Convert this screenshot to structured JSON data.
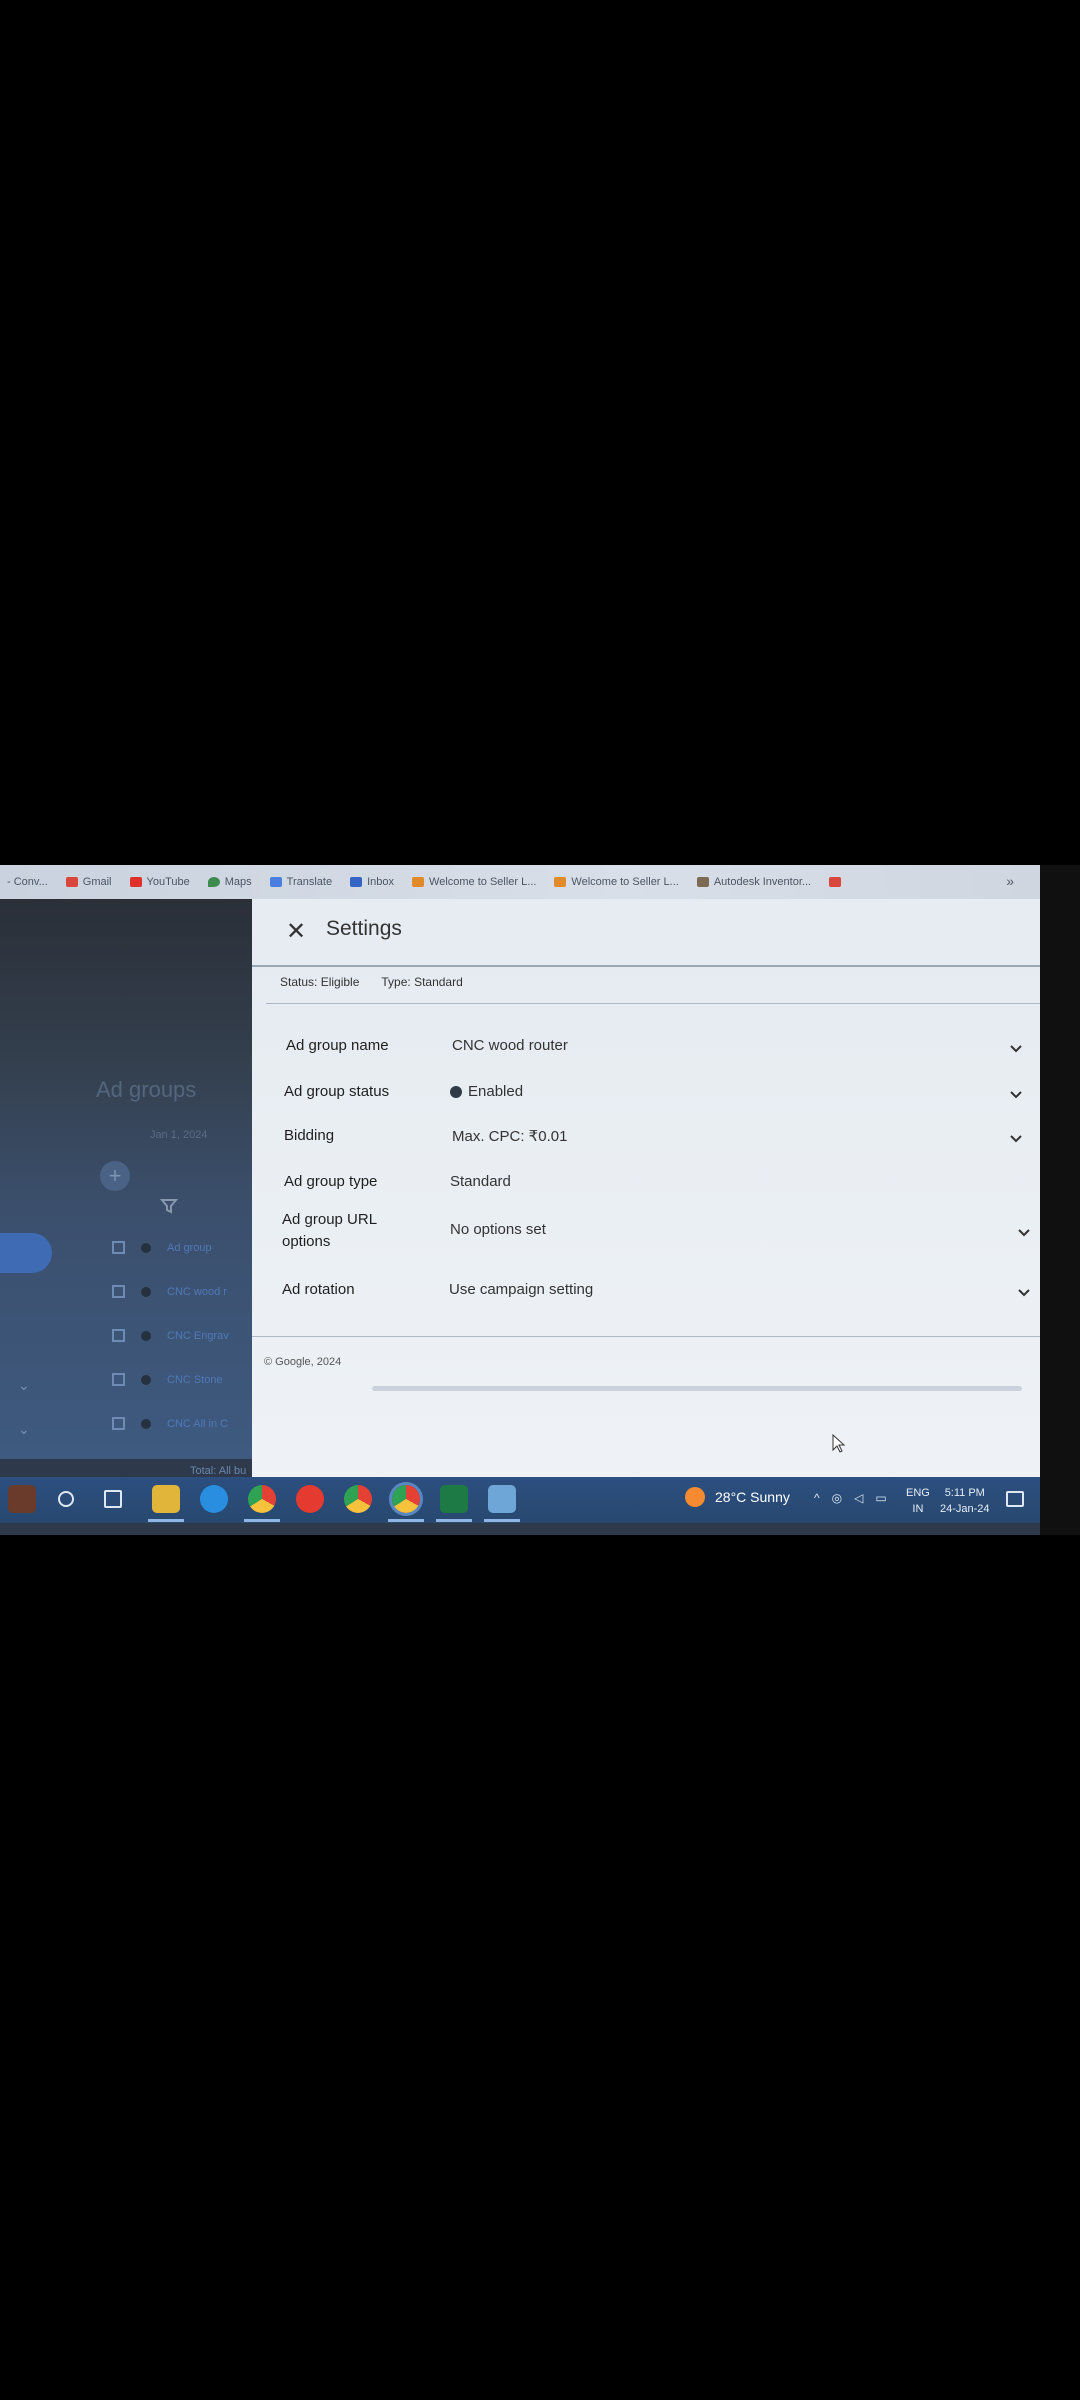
{
  "bookmarks": {
    "items": [
      {
        "label": "- Conv...",
        "icon": "blank-icon",
        "color": "#9aa3ad"
      },
      {
        "label": "Gmail",
        "icon": "gmail-icon",
        "color": "#d9463b"
      },
      {
        "label": "YouTube",
        "icon": "youtube-icon",
        "color": "#e0302a"
      },
      {
        "label": "Maps",
        "icon": "maps-pin-icon",
        "color": "#3f8a4f"
      },
      {
        "label": "Translate",
        "icon": "translate-icon",
        "color": "#4a7fe0"
      },
      {
        "label": "Inbox",
        "icon": "inbox-n-icon",
        "color": "#3565c4"
      },
      {
        "label": "Welcome to Seller L...",
        "icon": "seller-icon",
        "color": "#e08a2a"
      },
      {
        "label": "Welcome to Seller L...",
        "icon": "seller-icon",
        "color": "#e08a2a"
      },
      {
        "label": "Autodesk Inventor...",
        "icon": "autodesk-icon",
        "color": "#7d6a55"
      },
      {
        "label": "",
        "icon": "gmail-icon",
        "color": "#d9463b"
      }
    ],
    "more": "»"
  },
  "background_page": {
    "title": "Ad groups",
    "date": "Jan 1, 2024",
    "plus": "+",
    "rows": [
      "Ad group",
      "CNC wood r",
      "CNC Engrav",
      "CNC Stone",
      "CNC All in C"
    ],
    "total": "Total: All bu"
  },
  "settings": {
    "close": "✕",
    "title": "Settings",
    "status_label": "Status: Eligible",
    "type_label": "Type: Standard",
    "rows": [
      {
        "label": "Ad group name",
        "value": "CNC wood router",
        "chevron": true
      },
      {
        "label": "Ad group status",
        "value": "Enabled",
        "chevron": true,
        "dot": true
      },
      {
        "label": "Bidding",
        "value": "Max. CPC: ₹0.01",
        "chevron": true
      },
      {
        "label": "Ad group type",
        "value": "Standard",
        "chevron": false
      },
      {
        "label": "Ad group URL options",
        "value": "No options set",
        "chevron": true
      },
      {
        "label": "Ad rotation",
        "value": "Use campaign setting",
        "chevron": true
      }
    ],
    "footer": "© Google, 2024"
  },
  "taskbar": {
    "weather": "28°C  Sunny",
    "lang_top": "ENG",
    "lang_bottom": "IN",
    "time": "5:11 PM",
    "date": "24-Jan-24"
  }
}
